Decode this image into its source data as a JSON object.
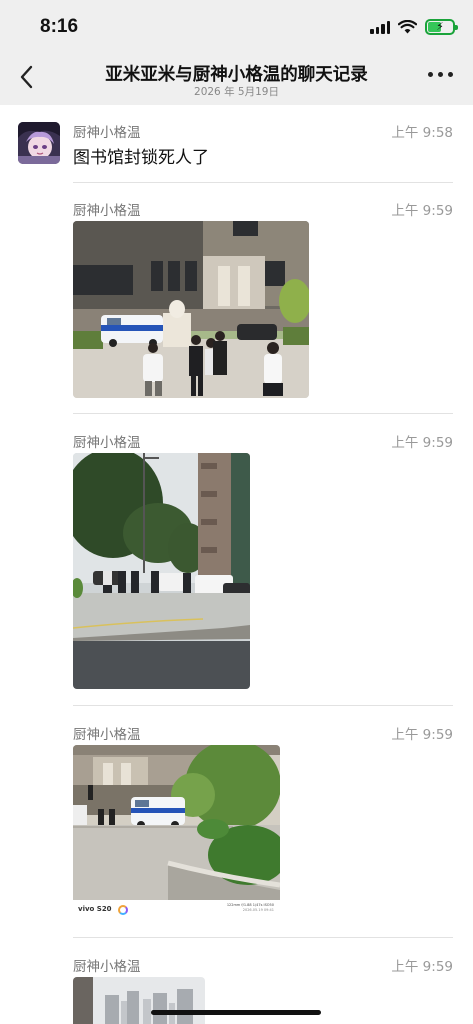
{
  "status_bar": {
    "time": "8:16"
  },
  "header": {
    "title": "亚米亚米与厨神小格温的聊天记录",
    "date": "2026 年 5月19日"
  },
  "messages": [
    {
      "sender": "厨神小格温",
      "time": "上午 9:58",
      "text": "图书馆封锁死人了"
    },
    {
      "sender": "厨神小格温",
      "time": "上午 9:59"
    },
    {
      "sender": "厨神小格温",
      "time": "上午 9:59"
    },
    {
      "sender": "厨神小格温",
      "time": "上午 9:59",
      "watermark": {
        "brand": "vivo S20",
        "specs": "122mm f/1.88 1/47s ISO50",
        "date": "2026.05.19 09:41"
      }
    },
    {
      "sender": "厨神小格温",
      "time": "上午 9:59"
    }
  ],
  "colors": {
    "header_bg": "#efefef",
    "divider": "#e2e2e2",
    "battery": "#35c659"
  }
}
